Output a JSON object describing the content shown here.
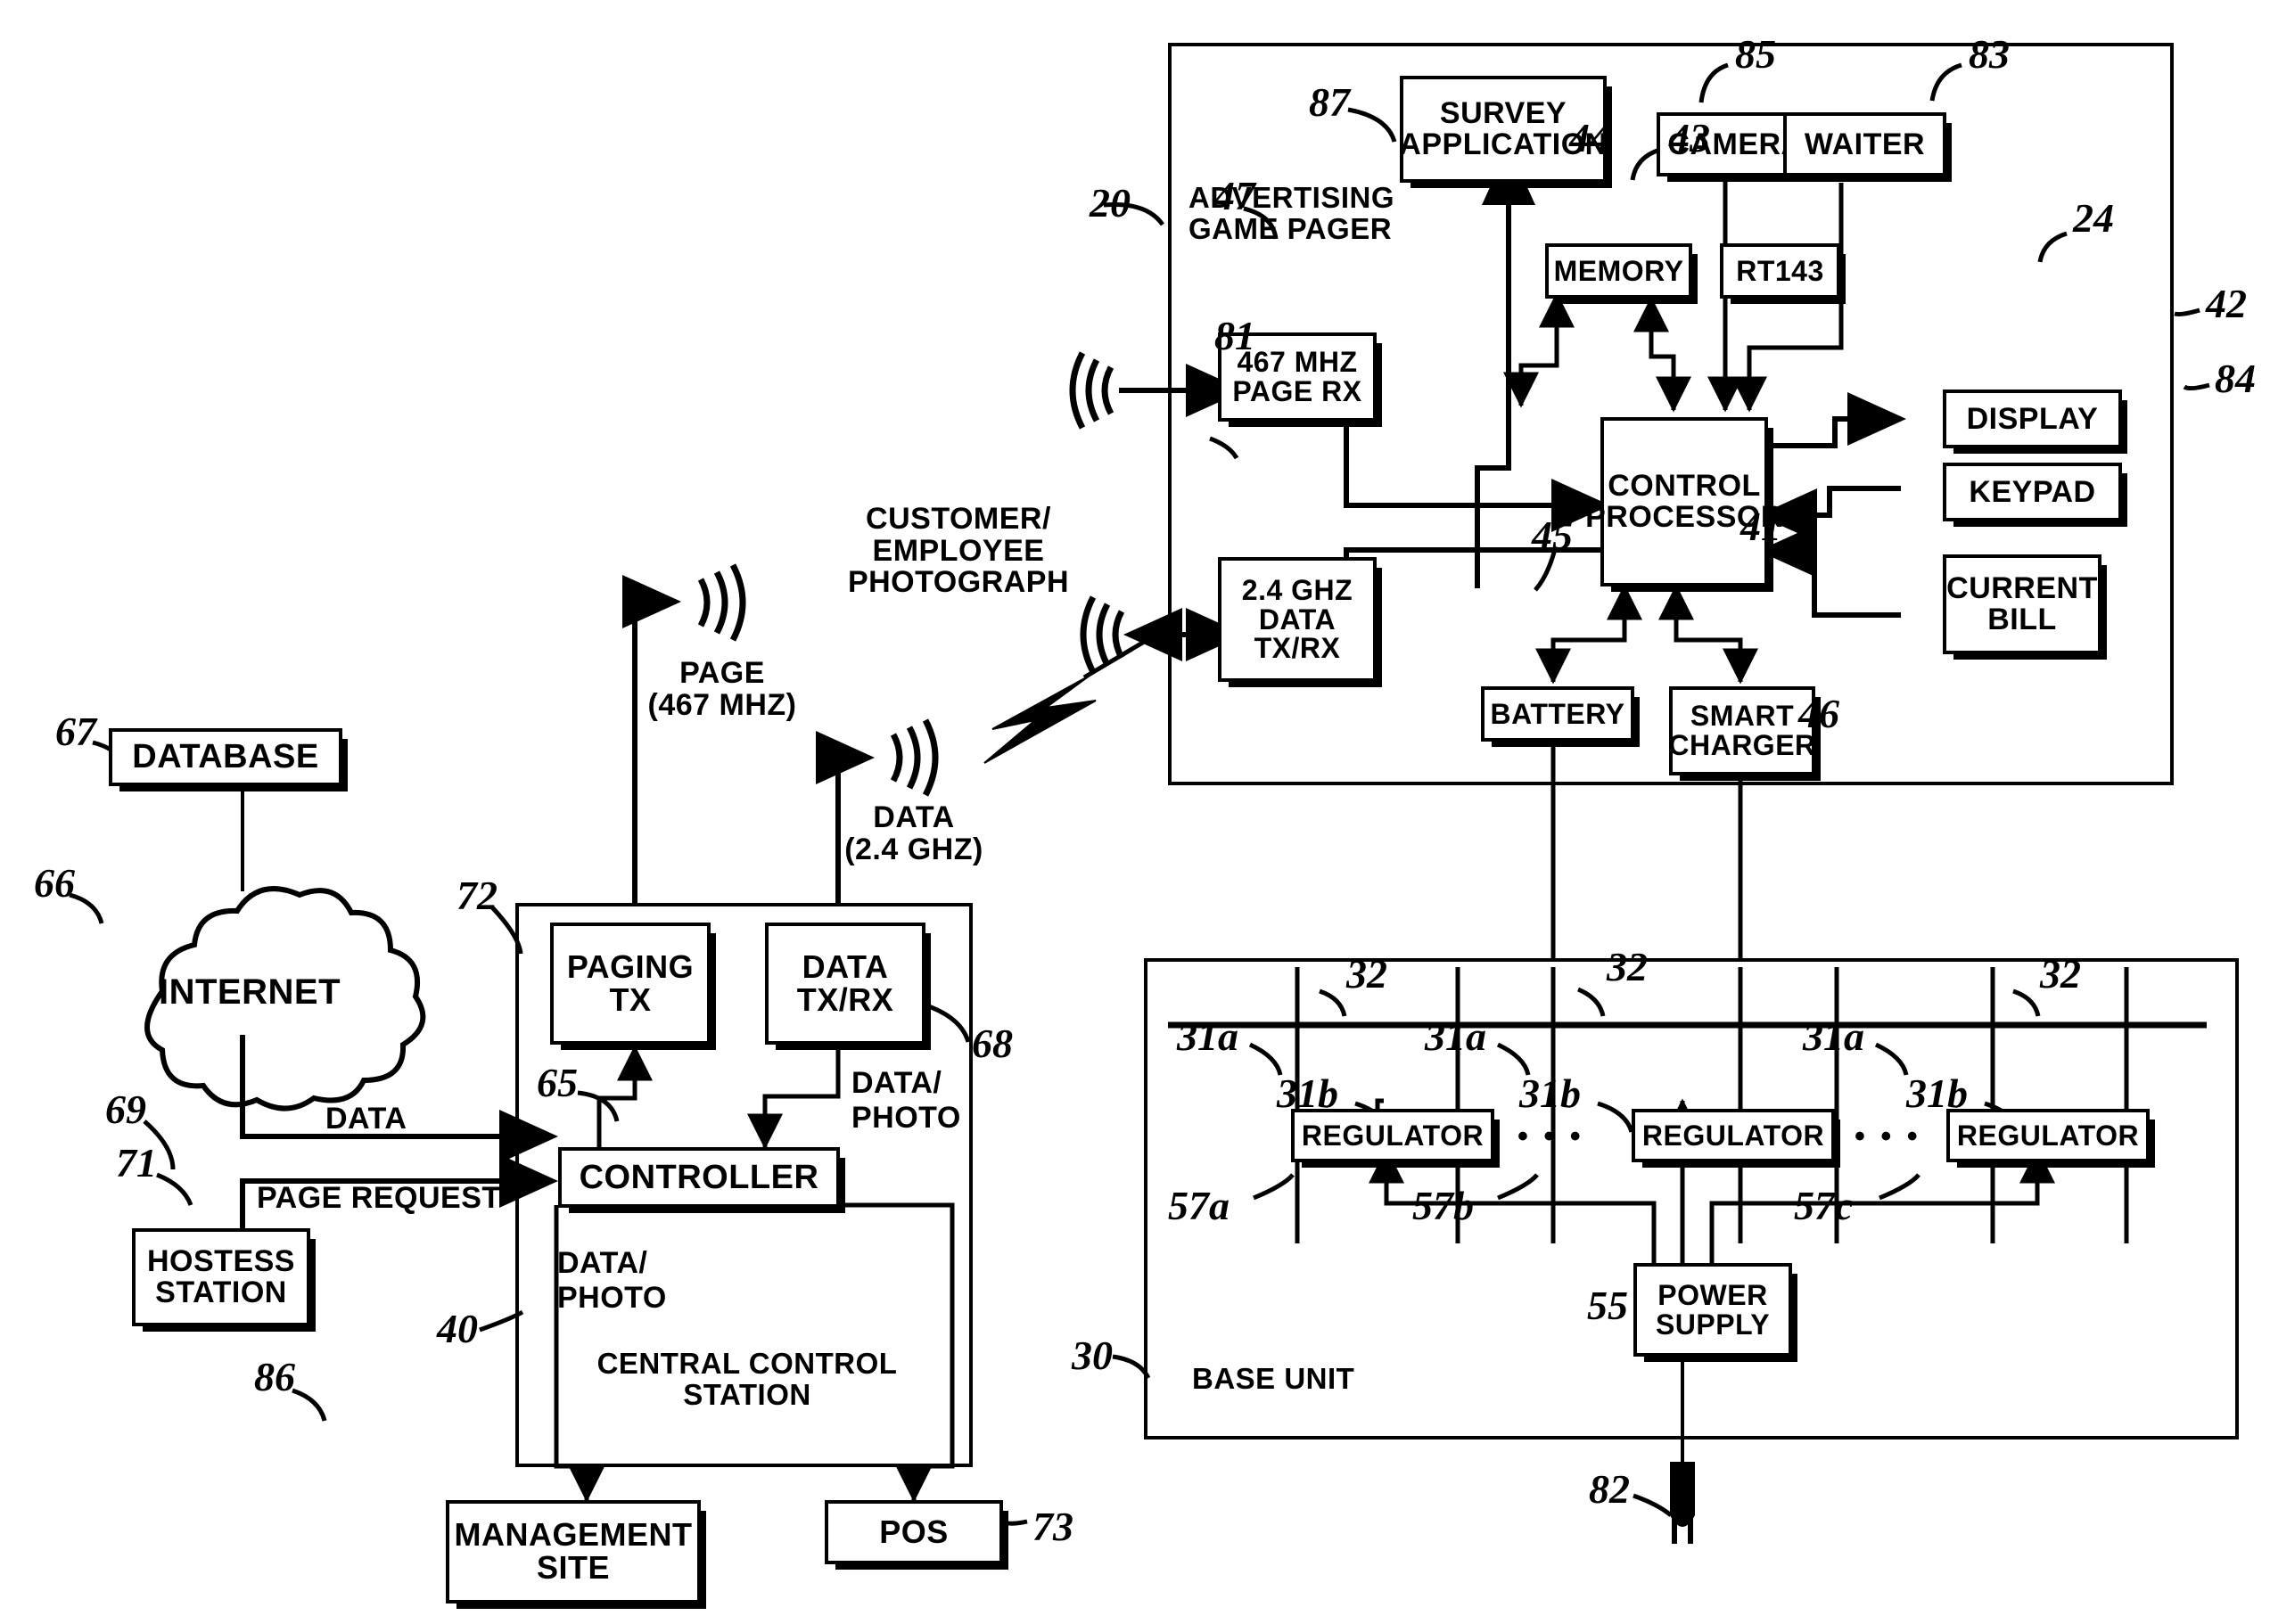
{
  "figure": {
    "domain": "patent-block-diagram",
    "line_color": "#000000",
    "background": "#ffffff"
  },
  "containers": [
    {
      "name": "advertising-game-pager",
      "label": "ADVERTISING\nGAME PAGER",
      "ref": "20"
    },
    {
      "name": "base-unit",
      "label": "BASE UNIT",
      "ref": "30"
    },
    {
      "name": "central-control-station",
      "label": "CENTRAL CONTROL\nSTATION",
      "ref": "40"
    }
  ],
  "pager_blocks": [
    {
      "name": "survey-application",
      "label": "SURVEY\nAPPLICATION",
      "ref": "87"
    },
    {
      "name": "camera",
      "label": "CAMERA",
      "ref": "85"
    },
    {
      "name": "waiter",
      "label": "WAITER",
      "ref": "83"
    },
    {
      "name": "memory",
      "label": "MEMORY",
      "ref": "44"
    },
    {
      "name": "rt143",
      "label": "RT143",
      "ref": "43"
    },
    {
      "name": "page-receiver",
      "label": "467 MHZ\nPAGE RX",
      "ref": "47"
    },
    {
      "name": "data-transceiver",
      "label": "2.4 GHZ\nDATA\nTX/RX",
      "ref": "81"
    },
    {
      "name": "control-processor",
      "label": "CONTROL\nPROCESSOR",
      "ref": "41"
    },
    {
      "name": "display",
      "label": "DISPLAY",
      "ref": "24"
    },
    {
      "name": "keypad",
      "label": "KEYPAD",
      "ref": "42"
    },
    {
      "name": "current-bill",
      "label": "CURRENT\nBILL",
      "ref": "84"
    },
    {
      "name": "battery",
      "label": "BATTERY",
      "ref": "45"
    },
    {
      "name": "smart-charger",
      "label": "SMART\nCHARGER",
      "ref": "46"
    }
  ],
  "ccs_blocks": [
    {
      "name": "paging-tx",
      "label": "PAGING\nTX",
      "ref": "72"
    },
    {
      "name": "data-tx-rx",
      "label": "DATA\nTX/RX",
      "ref": "68"
    },
    {
      "name": "controller",
      "label": "CONTROLLER",
      "ref": "65"
    }
  ],
  "external_blocks": [
    {
      "name": "database",
      "label": "DATABASE",
      "ref": "67"
    },
    {
      "name": "internet-cloud",
      "label": "INTERNET",
      "ref": "66"
    },
    {
      "name": "hostess-station",
      "label": "HOSTESS\nSTATION",
      "ref": "71"
    },
    {
      "name": "management-site",
      "label": "MANAGEMENT\nSITE",
      "ref": "86"
    },
    {
      "name": "pos",
      "label": "POS",
      "ref": "73"
    }
  ],
  "base_unit_blocks": [
    {
      "name": "regulator-1",
      "label": "REGULATOR",
      "ref_top": "31b",
      "ref_bay": "31a",
      "ref_slot": "32",
      "ref_out": "57a"
    },
    {
      "name": "regulator-2",
      "label": "REGULATOR",
      "ref_top": "31b",
      "ref_bay": "31a",
      "ref_slot": "32",
      "ref_out": "57b"
    },
    {
      "name": "regulator-3",
      "label": "REGULATOR",
      "ref_top": "31b",
      "ref_bay": "31a",
      "ref_slot": "32",
      "ref_out": "57c"
    },
    {
      "name": "power-supply",
      "label": "POWER\nSUPPLY",
      "ref": "55"
    }
  ],
  "base_unit_ellipses": [
    "• • •",
    "• • •"
  ],
  "flow_labels": {
    "page_rf": "PAGE\n(467 MHZ)",
    "data_rf": "DATA\n(2.4 GHZ)",
    "customer_photo": "CUSTOMER/\nEMPLOYEE\nPHOTOGRAPH",
    "data_link": "DATA",
    "page_request": "PAGE REQUEST",
    "data_photo_right": "DATA/\nPHOTO",
    "data_photo_left": "DATA/\nPHOTO"
  },
  "refs": {
    "internet_link": "69",
    "power_plug": "82"
  }
}
